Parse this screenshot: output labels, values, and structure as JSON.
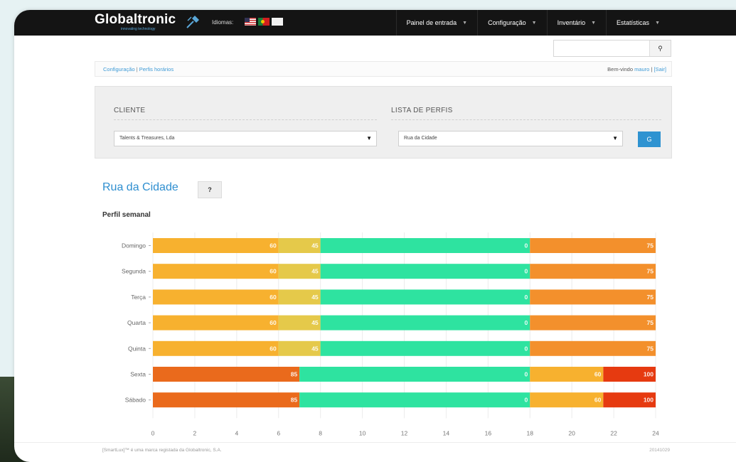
{
  "brand": {
    "name": "Globaltronic",
    "tagline": "innovating technology"
  },
  "nav": {
    "languages_label": "Idiomas:",
    "menu": [
      {
        "label": "Painel de entrada"
      },
      {
        "label": "Configuração"
      },
      {
        "label": "Inventário"
      },
      {
        "label": "Estatísticas"
      }
    ]
  },
  "search": {
    "value": "",
    "button_glyph": "⚲"
  },
  "breadcrumb": {
    "part1": "Configuração",
    "separator": " | ",
    "part2": "Perfis horários"
  },
  "welcome": {
    "prefix": "Bem-vindo ",
    "user": "mauro",
    "suffix": " | ",
    "logout": "[Sair]"
  },
  "filters": {
    "client_label": "CLIENTE",
    "client_value": "Talents & Treasures, Lda",
    "profiles_label": "LISTA DE PERFIS",
    "profile_value": "Rua da Cidade",
    "go_label": "G"
  },
  "profile": {
    "title": "Rua da Cidade",
    "help_label": "?",
    "weekly_title": "Perfil semanal"
  },
  "chart_data": {
    "type": "bar",
    "orientation": "horizontal-stacked",
    "xlim": [
      0,
      24
    ],
    "xticks": [
      0,
      2,
      4,
      6,
      8,
      10,
      12,
      14,
      16,
      18,
      20,
      22,
      24
    ],
    "categories": [
      "Domingo",
      "Segunda",
      "Terça",
      "Quarta",
      "Quinta",
      "Sexta",
      "Sábado"
    ],
    "colors": {
      "100": "#e63a10",
      "85": "#ea6a1c",
      "75": "#f3902c",
      "60": "#f7b12f",
      "45": "#e5c94a",
      "0": "#2ee3a0"
    },
    "rows": [
      {
        "day": "Domingo",
        "segments": [
          {
            "start": 0,
            "end": 6,
            "value": 60
          },
          {
            "start": 6,
            "end": 8,
            "value": 45
          },
          {
            "start": 8,
            "end": 18,
            "value": 0
          },
          {
            "start": 18,
            "end": 24,
            "value": 75
          }
        ]
      },
      {
        "day": "Segunda",
        "segments": [
          {
            "start": 0,
            "end": 6,
            "value": 60
          },
          {
            "start": 6,
            "end": 8,
            "value": 45
          },
          {
            "start": 8,
            "end": 18,
            "value": 0
          },
          {
            "start": 18,
            "end": 24,
            "value": 75
          }
        ]
      },
      {
        "day": "Terça",
        "segments": [
          {
            "start": 0,
            "end": 6,
            "value": 60
          },
          {
            "start": 6,
            "end": 8,
            "value": 45
          },
          {
            "start": 8,
            "end": 18,
            "value": 0
          },
          {
            "start": 18,
            "end": 24,
            "value": 75
          }
        ]
      },
      {
        "day": "Quarta",
        "segments": [
          {
            "start": 0,
            "end": 6,
            "value": 60
          },
          {
            "start": 6,
            "end": 8,
            "value": 45
          },
          {
            "start": 8,
            "end": 18,
            "value": 0
          },
          {
            "start": 18,
            "end": 24,
            "value": 75
          }
        ]
      },
      {
        "day": "Quinta",
        "segments": [
          {
            "start": 0,
            "end": 6,
            "value": 60
          },
          {
            "start": 6,
            "end": 8,
            "value": 45
          },
          {
            "start": 8,
            "end": 18,
            "value": 0
          },
          {
            "start": 18,
            "end": 24,
            "value": 75
          }
        ]
      },
      {
        "day": "Sexta",
        "segments": [
          {
            "start": 0,
            "end": 7,
            "value": 85
          },
          {
            "start": 7,
            "end": 18,
            "value": 0
          },
          {
            "start": 18,
            "end": 21.5,
            "value": 60
          },
          {
            "start": 21.5,
            "end": 24,
            "value": 100
          }
        ]
      },
      {
        "day": "Sábado",
        "segments": [
          {
            "start": 0,
            "end": 7,
            "value": 85
          },
          {
            "start": 7,
            "end": 18,
            "value": 0
          },
          {
            "start": 18,
            "end": 21.5,
            "value": 60
          },
          {
            "start": 21.5,
            "end": 24,
            "value": 100
          }
        ]
      }
    ]
  },
  "footer": {
    "left": "[SmartLux]™ é uma marca registada da Globaltronic, S.A.",
    "right": "20141029"
  }
}
